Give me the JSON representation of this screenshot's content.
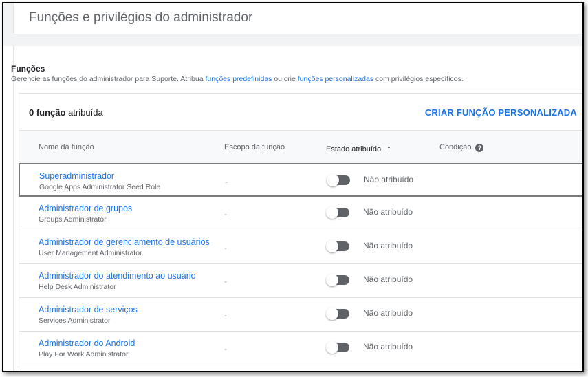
{
  "page": {
    "title": "Funções e privilégios do administrador"
  },
  "section": {
    "title": "Funções",
    "desc_prefix": "Gerencie as funções do administrador para Suporte. Atribua ",
    "desc_link1": "funções predefinidas",
    "desc_mid": " ou crie ",
    "desc_link2": "funções personalizadas",
    "desc_suffix": " com privilégios específicos."
  },
  "table": {
    "assigned_count": "0 função",
    "assigned_suffix": " atribuída",
    "create_button": "CRIAR FUNÇÃO PERSONALIZADA",
    "columns": {
      "name": "Nome da função",
      "scope": "Escopo da função",
      "state": "Estado atribuído",
      "state_sort_arrow": "↑",
      "condition": "Condição",
      "condition_help": "?"
    },
    "rows": [
      {
        "name": "Superadministrador",
        "sub": "Google Apps Administrator Seed Role",
        "scope": "-",
        "state": "Não atribuído"
      },
      {
        "name": "Administrador de grupos",
        "sub": "Groups Administrator",
        "scope": "-",
        "state": "Não atribuído"
      },
      {
        "name": "Administrador de gerenciamento de usuários",
        "sub": "User Management Administrator",
        "scope": "-",
        "state": "Não atribuído"
      },
      {
        "name": "Administrador do atendimento ao usuário",
        "sub": "Help Desk Administrator",
        "scope": "-",
        "state": "Não atribuído"
      },
      {
        "name": "Administrador de serviços",
        "sub": "Services Administrator",
        "scope": "-",
        "state": "Não atribuído"
      },
      {
        "name": "Administrador do Android",
        "sub": "Play For Work Administrator",
        "scope": "-",
        "state": "Não atribuído"
      }
    ]
  },
  "colors": {
    "link": "#1a73e8",
    "secondary_text": "#5f6368",
    "toggle_off": "#5f6368"
  }
}
